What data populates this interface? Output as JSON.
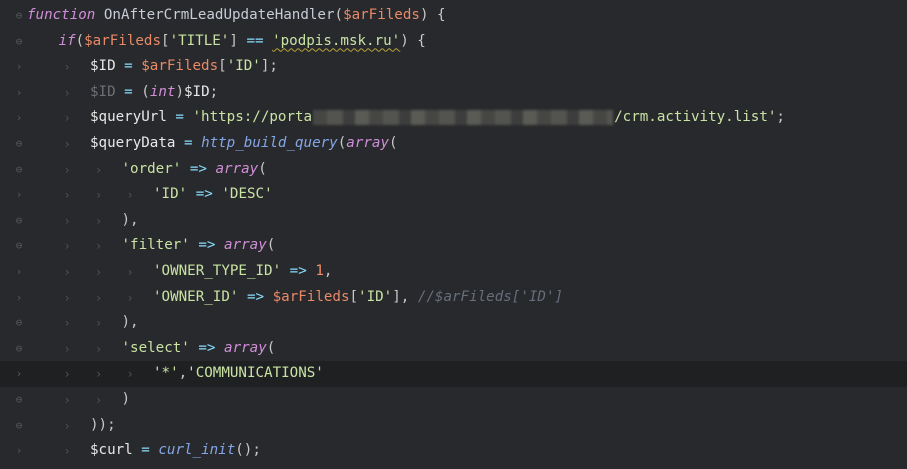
{
  "lines": [
    {
      "marker": "⊖",
      "guides": 0,
      "current": false,
      "tokens": [
        {
          "t": "function",
          "c": "kw"
        },
        {
          "t": " ",
          "c": "pun"
        },
        {
          "t": "OnAfterCrmLeadUpdateHandler",
          "c": "dname"
        },
        {
          "t": "(",
          "c": "pun"
        },
        {
          "t": "$arFileds",
          "c": "var"
        },
        {
          "t": ") {",
          "c": "pun"
        }
      ]
    },
    {
      "marker": "⊖",
      "guides": 1,
      "current": false,
      "tokens": [
        {
          "t": "if",
          "c": "kw"
        },
        {
          "t": "(",
          "c": "pun"
        },
        {
          "t": "$arFileds",
          "c": "var"
        },
        {
          "t": "[",
          "c": "pun"
        },
        {
          "t": "'TITLE'",
          "c": "str"
        },
        {
          "t": "] ",
          "c": "pun"
        },
        {
          "t": "==",
          "c": "op"
        },
        {
          "t": " ",
          "c": "pun"
        },
        {
          "t": "'podpis.msk.ru'",
          "c": "str squig"
        },
        {
          "t": ") {",
          "c": "pun"
        }
      ]
    },
    {
      "marker": "›",
      "guides": 2,
      "current": false,
      "tokens": [
        {
          "t": "$ID",
          "c": "vdef"
        },
        {
          "t": " ",
          "c": "pun"
        },
        {
          "t": "=",
          "c": "op"
        },
        {
          "t": " ",
          "c": "pun"
        },
        {
          "t": "$arFileds",
          "c": "var"
        },
        {
          "t": "[",
          "c": "pun"
        },
        {
          "t": "'ID'",
          "c": "str"
        },
        {
          "t": "];",
          "c": "pun"
        }
      ]
    },
    {
      "marker": "›",
      "guides": 2,
      "current": false,
      "tokens": [
        {
          "t": "$ID",
          "c": "dim"
        },
        {
          "t": " ",
          "c": "pun"
        },
        {
          "t": "=",
          "c": "op"
        },
        {
          "t": " (",
          "c": "pun"
        },
        {
          "t": "int",
          "c": "kw"
        },
        {
          "t": ")",
          "c": "pun"
        },
        {
          "t": "$ID",
          "c": "vdef"
        },
        {
          "t": ";",
          "c": "pun"
        }
      ]
    },
    {
      "marker": "›",
      "guides": 2,
      "current": false,
      "blur_after": 0,
      "tokens": [
        {
          "t": "$queryUrl",
          "c": "vdef"
        },
        {
          "t": " ",
          "c": "pun"
        },
        {
          "t": "=",
          "c": "op"
        },
        {
          "t": " ",
          "c": "pun"
        },
        {
          "t": "'https://porta",
          "c": "str"
        },
        {
          "t": "",
          "c": "blur"
        },
        {
          "t": "/crm.activity.list'",
          "c": "str"
        },
        {
          "t": ";",
          "c": "pun"
        }
      ]
    },
    {
      "marker": "⊖",
      "guides": 2,
      "current": false,
      "tokens": [
        {
          "t": "$queryData",
          "c": "vdef"
        },
        {
          "t": " ",
          "c": "pun"
        },
        {
          "t": "=",
          "c": "op"
        },
        {
          "t": " ",
          "c": "pun"
        },
        {
          "t": "http_build_query",
          "c": "fn"
        },
        {
          "t": "(",
          "c": "pun"
        },
        {
          "t": "array",
          "c": "kw"
        },
        {
          "t": "(",
          "c": "pun"
        }
      ]
    },
    {
      "marker": "⊖",
      "guides": 3,
      "current": false,
      "tokens": [
        {
          "t": "'order'",
          "c": "str"
        },
        {
          "t": " ",
          "c": "pun"
        },
        {
          "t": "=>",
          "c": "op"
        },
        {
          "t": " ",
          "c": "pun"
        },
        {
          "t": "array",
          "c": "kw"
        },
        {
          "t": "(",
          "c": "pun"
        }
      ]
    },
    {
      "marker": "›",
      "guides": 4,
      "current": false,
      "tokens": [
        {
          "t": "'ID'",
          "c": "str"
        },
        {
          "t": " ",
          "c": "pun"
        },
        {
          "t": "=>",
          "c": "op"
        },
        {
          "t": " ",
          "c": "pun"
        },
        {
          "t": "'DESC'",
          "c": "str"
        }
      ]
    },
    {
      "marker": "⊖",
      "guides": 3,
      "current": false,
      "tokens": [
        {
          "t": "),",
          "c": "pun"
        }
      ]
    },
    {
      "marker": "⊖",
      "guides": 3,
      "current": false,
      "tokens": [
        {
          "t": "'filter'",
          "c": "str"
        },
        {
          "t": " ",
          "c": "pun"
        },
        {
          "t": "=>",
          "c": "op"
        },
        {
          "t": " ",
          "c": "pun"
        },
        {
          "t": "array",
          "c": "kw"
        },
        {
          "t": "(",
          "c": "pun"
        }
      ]
    },
    {
      "marker": "›",
      "guides": 4,
      "current": false,
      "tokens": [
        {
          "t": "'OWNER_TYPE_ID'",
          "c": "str"
        },
        {
          "t": " ",
          "c": "pun"
        },
        {
          "t": "=>",
          "c": "op"
        },
        {
          "t": " ",
          "c": "pun"
        },
        {
          "t": "1",
          "c": "num"
        },
        {
          "t": ",",
          "c": "pun"
        }
      ]
    },
    {
      "marker": "›",
      "guides": 4,
      "current": false,
      "tokens": [
        {
          "t": "'OWNER_ID'",
          "c": "str"
        },
        {
          "t": " ",
          "c": "pun"
        },
        {
          "t": "=>",
          "c": "op"
        },
        {
          "t": " ",
          "c": "pun"
        },
        {
          "t": "$arFileds",
          "c": "var"
        },
        {
          "t": "[",
          "c": "pun"
        },
        {
          "t": "'ID'",
          "c": "str"
        },
        {
          "t": "], ",
          "c": "pun"
        },
        {
          "t": "//$arFileds['ID']",
          "c": "cmt"
        }
      ]
    },
    {
      "marker": "⊖",
      "guides": 3,
      "current": false,
      "tokens": [
        {
          "t": "),",
          "c": "pun"
        }
      ]
    },
    {
      "marker": "⊖",
      "guides": 3,
      "current": false,
      "tokens": [
        {
          "t": "'select'",
          "c": "str"
        },
        {
          "t": " ",
          "c": "pun"
        },
        {
          "t": "=>",
          "c": "op"
        },
        {
          "t": " ",
          "c": "pun"
        },
        {
          "t": "array",
          "c": "kw"
        },
        {
          "t": "(",
          "c": "pun"
        }
      ]
    },
    {
      "marker": "›",
      "guides": 4,
      "current": true,
      "tokens": [
        {
          "t": "'*'",
          "c": "str"
        },
        {
          "t": ",",
          "c": "pun"
        },
        {
          "t": "'COMMUNICATIONS'",
          "c": "str"
        }
      ]
    },
    {
      "marker": "⊖",
      "guides": 3,
      "current": false,
      "tokens": [
        {
          "t": ")",
          "c": "pun"
        }
      ]
    },
    {
      "marker": "⊖",
      "guides": 2,
      "current": false,
      "tokens": [
        {
          "t": "));",
          "c": "pun"
        }
      ]
    },
    {
      "marker": "›",
      "guides": 2,
      "current": false,
      "tokens": [
        {
          "t": "$curl",
          "c": "vdef"
        },
        {
          "t": " ",
          "c": "pun"
        },
        {
          "t": "=",
          "c": "op"
        },
        {
          "t": " ",
          "c": "pun"
        },
        {
          "t": "curl_init",
          "c": "fn"
        },
        {
          "t": "();",
          "c": "pun"
        }
      ]
    }
  ]
}
